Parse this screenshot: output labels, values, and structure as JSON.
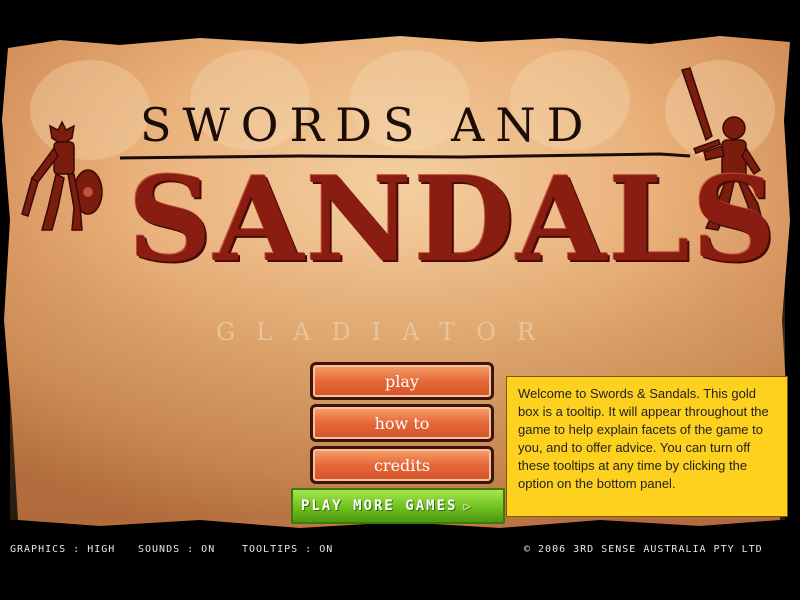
{
  "title": {
    "line1": "SWORDS AND",
    "line2": "SANDALS",
    "subtitle": "GLADIATOR"
  },
  "menu": {
    "play": "play",
    "how_to": "how to",
    "credits": "credits",
    "more_games": "PLAY MORE GAMES"
  },
  "tooltip": {
    "text": "Welcome to Swords & Sandals. This gold box is a tooltip. It will appear throughout the game to help explain facets of the game to you, and to offer advice. You can turn off these tooltips at any time by clicking the option on the bottom panel."
  },
  "options": {
    "graphics": "GRAPHICS : HIGH",
    "sounds": "SOUNDS : ON",
    "tooltips": "TOOLTIPS : ON"
  },
  "copyright": "© 2006 3RD SENSE AUSTRALIA PTY LTD",
  "colors": {
    "parchment": "#e9b07a",
    "title_red": "#8a1d12",
    "tooltip_gold": "#ffd11f",
    "button_orange": "#e5683a",
    "more_games_green": "#6fbf1f"
  }
}
